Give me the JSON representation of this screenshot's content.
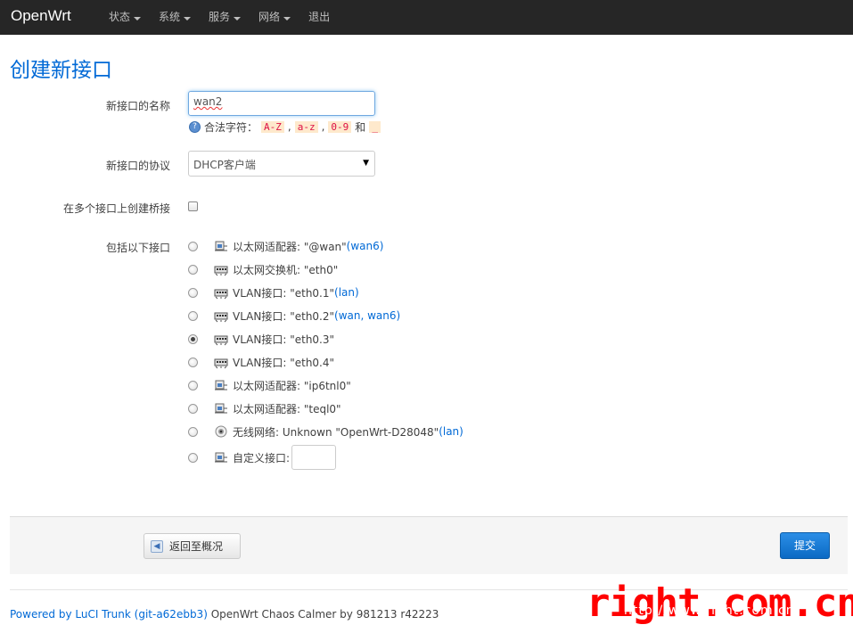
{
  "navbar": {
    "brand": "OpenWrt",
    "menu": [
      {
        "label": "状态",
        "dropdown": true
      },
      {
        "label": "系统",
        "dropdown": true
      },
      {
        "label": "服务",
        "dropdown": true
      },
      {
        "label": "网络",
        "dropdown": true
      },
      {
        "label": "退出",
        "dropdown": false
      }
    ]
  },
  "page": {
    "title": "创建新接口"
  },
  "form": {
    "name_label": "新接口的名称",
    "name_value": "wan2",
    "hint_prefix": "合法字符：",
    "hint_codes": [
      "A-Z",
      "a-z",
      "0-9"
    ],
    "hint_and": "和",
    "hint_last": "_",
    "protocol_label": "新接口的协议",
    "protocol_value": "DHCP客户端",
    "bridge_label": "在多个接口上创建桥接",
    "bridge_checked": false,
    "include_label": "包括以下接口",
    "interfaces": [
      {
        "icon": "ethernet-adapter-icon",
        "text": "以太网适配器: \"@wan\" ",
        "links": "(wan6)",
        "checked": false
      },
      {
        "icon": "switch-icon",
        "text": "以太网交换机: \"eth0\"",
        "links": "",
        "checked": false
      },
      {
        "icon": "switch-icon",
        "text": "VLAN接口: \"eth0.1\" ",
        "links": "(lan)",
        "checked": false
      },
      {
        "icon": "switch-icon",
        "text": "VLAN接口: \"eth0.2\" ",
        "links": "(wan, wan6)",
        "checked": false
      },
      {
        "icon": "switch-icon",
        "text": "VLAN接口: \"eth0.3\"",
        "links": "",
        "checked": true
      },
      {
        "icon": "switch-icon",
        "text": "VLAN接口: \"eth0.4\"",
        "links": "",
        "checked": false
      },
      {
        "icon": "ethernet-adapter-icon",
        "text": "以太网适配器: \"ip6tnl0\"",
        "links": "",
        "checked": false
      },
      {
        "icon": "ethernet-adapter-icon",
        "text": "以太网适配器: \"teql0\"",
        "links": "",
        "checked": false
      },
      {
        "icon": "wireless-icon",
        "text": "无线网络: Unknown \"OpenWrt-D28048\" ",
        "links": "(lan)",
        "checked": false
      },
      {
        "icon": "ethernet-adapter-icon",
        "text": "自定义接口:",
        "links": "",
        "checked": false
      }
    ],
    "custom_interface_value": ""
  },
  "actions": {
    "back_label": "返回至概况",
    "submit_label": "提交"
  },
  "footer": {
    "powered_by": "Powered by LuCI Trunk (git-a62ebb3)",
    "version": " OpenWrt Chaos Calmer by 981213 r42223"
  },
  "watermark": {
    "text": "right.com.cn",
    "url": "http://www.right.com.cn"
  },
  "colors": {
    "navbar_bg": "#262626",
    "link": "#0069d6",
    "submit_bg": "#0b6ac4",
    "watermark": "#ff0000"
  }
}
